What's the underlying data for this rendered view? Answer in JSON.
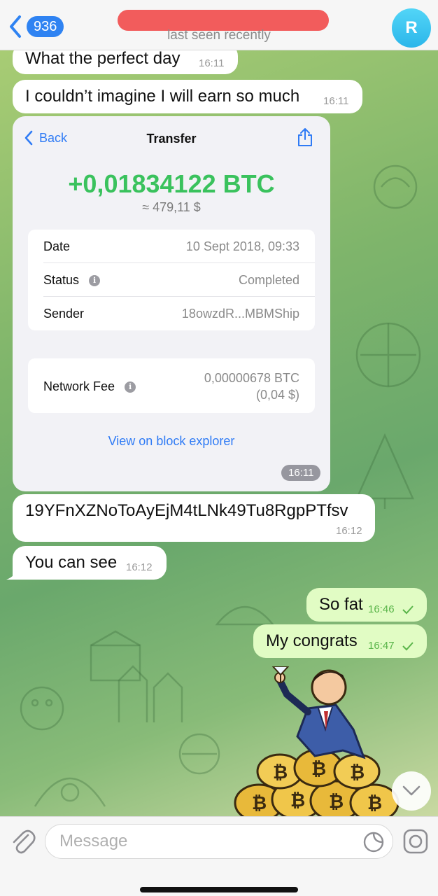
{
  "header": {
    "back_count": "936",
    "status": "last seen recently",
    "avatar_initial": "R"
  },
  "messages": [
    {
      "text": "What the perfect day",
      "time": "16:11"
    },
    {
      "text": "I couldn’t imagine I will earn so much",
      "time": "16:11"
    },
    {
      "text": "19YFnXZNoToAyEjM4tLNk49Tu8RgpPTfsv",
      "time": "16:12"
    },
    {
      "text": "You can see",
      "time": "16:12"
    },
    {
      "text": "So fat",
      "time": "16:46"
    },
    {
      "text": "My congrats",
      "time": "16:47"
    }
  ],
  "transfer_card": {
    "back_label": "Back",
    "title": "Transfer",
    "amount": "+0,01834122 BTC",
    "fiat": "≈ 479,11 $",
    "rows": [
      {
        "label": "Date",
        "value": "10 Sept 2018, 09:33"
      },
      {
        "label": "Status",
        "value": "Completed"
      },
      {
        "label": "Sender",
        "value": "18owzdR...MBMShip"
      }
    ],
    "fee_label": "Network Fee",
    "fee_btc": "0,00000678 BTC",
    "fee_fiat": "(0,04 $)",
    "explorer_link": "View on block explorer",
    "time": "16:11"
  },
  "composer": {
    "placeholder": "Message"
  },
  "colors": {
    "accent": "#2f83f2",
    "amount_green": "#3ac25d",
    "outgoing_bubble": "#e1fcc4"
  }
}
